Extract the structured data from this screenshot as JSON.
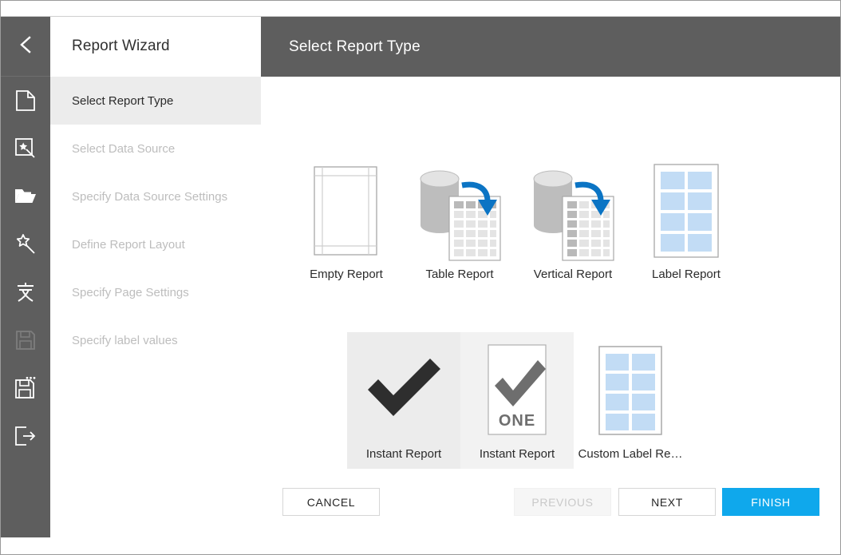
{
  "window": {
    "accent_color": "#0fa8ec",
    "rail_color": "#5e5e5e",
    "header_color": "#5e5e5e",
    "active_step_color": "#ececec",
    "selected_card_color": "#ececec"
  },
  "rail": {
    "back_icon": "chevron-left-icon",
    "items": [
      {
        "icon": "new-document-icon",
        "enabled": true
      },
      {
        "icon": "report-wizard-icon",
        "enabled": true
      },
      {
        "icon": "open-folder-icon",
        "enabled": true
      },
      {
        "icon": "magic-wand-icon",
        "enabled": true
      },
      {
        "icon": "text-cjk-icon",
        "enabled": true
      },
      {
        "icon": "save-icon",
        "enabled": false
      },
      {
        "icon": "save-as-icon",
        "enabled": true
      },
      {
        "icon": "exit-icon",
        "enabled": true
      }
    ]
  },
  "wizard": {
    "title": "Report Wizard",
    "steps": [
      {
        "label": "Select Report Type",
        "active": true
      },
      {
        "label": "Select Data Source",
        "active": false
      },
      {
        "label": "Specify Data Source Settings",
        "active": false
      },
      {
        "label": "Define Report Layout",
        "active": false
      },
      {
        "label": "Specify Page Settings",
        "active": false
      },
      {
        "label": "Specify label values",
        "active": false
      }
    ]
  },
  "header": {
    "title": "Select Report Type"
  },
  "report_types": {
    "row1": [
      {
        "label": "Empty Report",
        "art": "empty-page-art",
        "state": "normal"
      },
      {
        "label": "Table Report",
        "art": "table-report-art",
        "state": "normal"
      },
      {
        "label": "Vertical Report",
        "art": "vertical-report-art",
        "state": "normal"
      },
      {
        "label": "Label Report",
        "art": "label-report-art",
        "state": "normal"
      }
    ],
    "row2": [
      {
        "label": "Instant Report",
        "art": "check-dark-art",
        "state": "selected"
      },
      {
        "label": "Instant Report",
        "art": "check-one-art",
        "state": "hovered"
      },
      {
        "label": "Custom Label Re…",
        "art": "custom-label-art",
        "state": "normal"
      }
    ]
  },
  "footer": {
    "cancel_label": "CANCEL",
    "previous_label": "PREVIOUS",
    "next_label": "NEXT",
    "finish_label": "FINISH"
  }
}
